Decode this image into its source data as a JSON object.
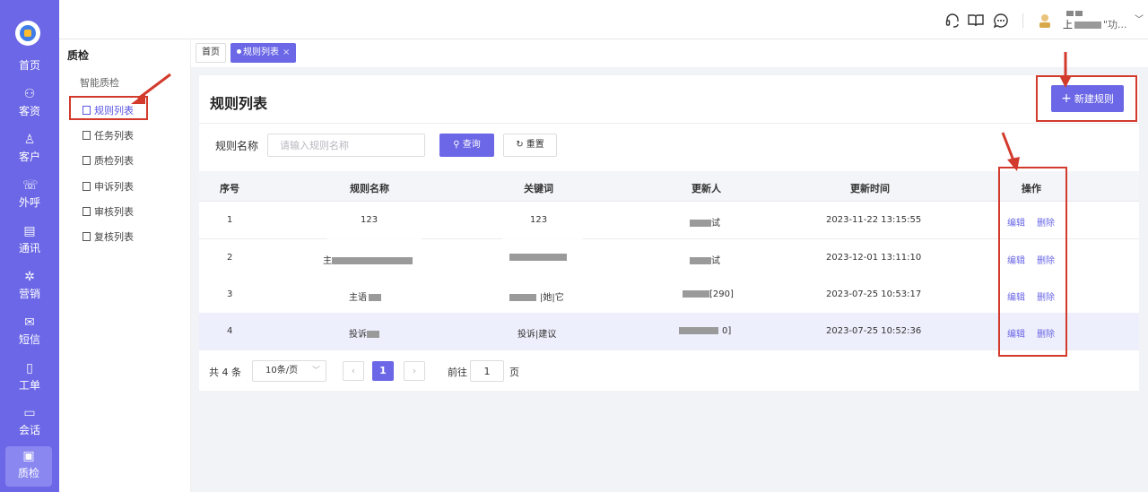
{
  "rail": {
    "items": [
      {
        "label": "首页",
        "icon": "home-icon"
      },
      {
        "label": "客资",
        "icon": "users-icon"
      },
      {
        "label": "客户",
        "icon": "customer-icon"
      },
      {
        "label": "外呼",
        "icon": "phone-out-icon"
      },
      {
        "label": "通讯",
        "icon": "contacts-icon"
      },
      {
        "label": "营销",
        "icon": "marketing-icon"
      },
      {
        "label": "短信",
        "icon": "sms-icon"
      },
      {
        "label": "工单",
        "icon": "clipboard-icon"
      },
      {
        "label": "会话",
        "icon": "chat-icon"
      },
      {
        "label": "质检",
        "icon": "quality-icon"
      }
    ],
    "active": "质检"
  },
  "topbar": {
    "icons": [
      "headset-icon",
      "book-icon",
      "message-icon"
    ],
    "user_label": "上"
  },
  "subnav": {
    "title": "质检",
    "group": "智能质检",
    "items": [
      "规则列表",
      "任务列表",
      "质检列表",
      "申诉列表",
      "审核列表",
      "复核列表"
    ]
  },
  "tabs": {
    "home": "首页",
    "active": "规则列表",
    "close": "×"
  },
  "page": {
    "title": "规则列表",
    "new_button": "新建规则",
    "new_icon": "+"
  },
  "filter": {
    "label": "规则名称",
    "placeholder": "请输入规则名称",
    "query": "查询",
    "reset": "重置"
  },
  "table": {
    "headers": [
      "序号",
      "规则名称",
      "关键词",
      "更新人",
      "更新时间",
      "操作"
    ],
    "rows": [
      {
        "no": "1",
        "name": "123",
        "keyword": "123",
        "updater": "试",
        "time": "2023-11-22 13:15:55"
      },
      {
        "no": "2",
        "name": "主",
        "keyword": "",
        "updater": "试",
        "time": "2023-12-01 13:11:10"
      },
      {
        "no": "3",
        "name": "主语",
        "keyword": "|她|它",
        "updater": "[290]",
        "time": "2023-07-25 10:53:17"
      },
      {
        "no": "4",
        "name": "投诉",
        "keyword": "投诉|建议",
        "updater": "0]",
        "time": "2023-07-25 10:52:36"
      }
    ],
    "edit": "编辑",
    "delete": "删除"
  },
  "pagination": {
    "total": "共 4 条",
    "page_size": "10条/页",
    "current": "1",
    "goto_label": "前往",
    "goto_value": "1",
    "page_label": "页",
    "prev": "‹",
    "next": "›"
  },
  "colors": {
    "accent": "#6b67e6",
    "annotation": "#d23a2c"
  }
}
